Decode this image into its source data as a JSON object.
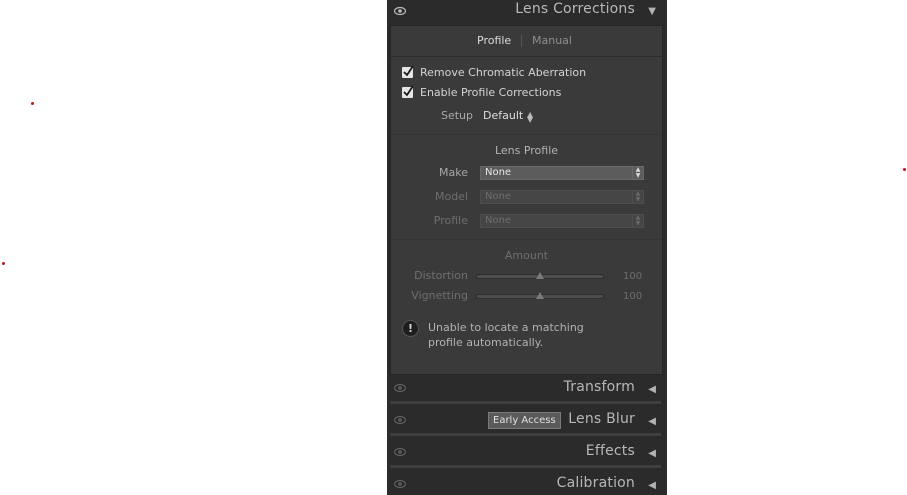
{
  "panels": {
    "lens_corrections": {
      "title": "Lens Corrections",
      "arrow": "▼",
      "tab_profile": "Profile",
      "tab_manual": "Manual"
    },
    "transform": {
      "title": "Transform",
      "arrow": "◀"
    },
    "lens_blur": {
      "title": "Lens Blur",
      "arrow": "◀",
      "badge": "Early Access"
    },
    "effects": {
      "title": "Effects",
      "arrow": "◀"
    },
    "calibration": {
      "title": "Calibration",
      "arrow": "◀"
    }
  },
  "options": {
    "remove_ca": {
      "label": "Remove Chromatic Aberration",
      "checked": true
    },
    "enable_profile": {
      "label": "Enable Profile Corrections",
      "checked": true
    }
  },
  "setup": {
    "label": "Setup",
    "value": "Default"
  },
  "lens_profile": {
    "heading": "Lens Profile",
    "make": {
      "label": "Make",
      "value": "None"
    },
    "model": {
      "label": "Model",
      "value": "None"
    },
    "profile": {
      "label": "Profile",
      "value": "None"
    }
  },
  "amount": {
    "heading": "Amount",
    "distortion": {
      "label": "Distortion",
      "value": "100"
    },
    "vignetting": {
      "label": "Vignetting",
      "value": "100"
    }
  },
  "warning": {
    "text": "Unable to locate a matching profile automatically."
  },
  "colors": {
    "accent_dot": "#c41a1a",
    "panel_bg": "#2b2b2b",
    "content_bg": "#3a3a3a"
  },
  "icons": [
    "eye-icon",
    "checkmark-icon",
    "warning-icon",
    "chevron-down-icon",
    "chevron-left-icon"
  ]
}
